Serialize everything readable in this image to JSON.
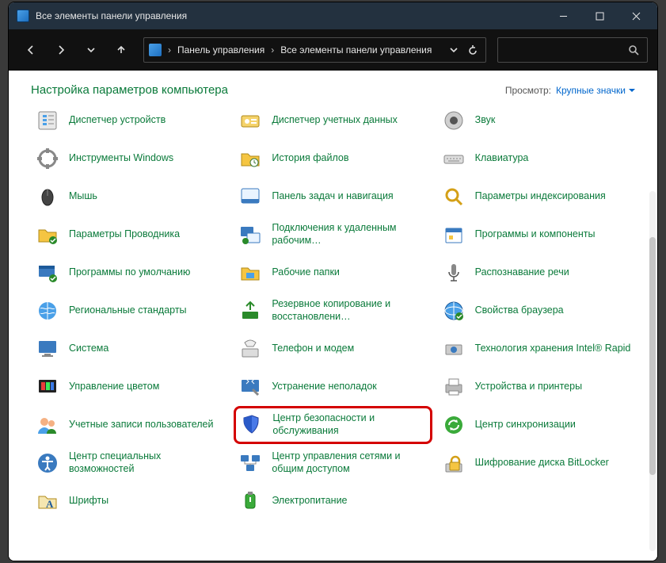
{
  "window": {
    "title": "Все элементы панели управления"
  },
  "breadcrumb": {
    "seg1": "Панель управления",
    "seg2": "Все элементы панели управления"
  },
  "header": {
    "title": "Настройка параметров компьютера",
    "view_label": "Просмотр:",
    "view_value": "Крупные значки"
  },
  "items": [
    {
      "label": "Диспетчер устройств",
      "icon": "device-manager-icon"
    },
    {
      "label": "Диспетчер учетных данных",
      "icon": "credentials-icon"
    },
    {
      "label": "Звук",
      "icon": "sound-icon"
    },
    {
      "label": "Инструменты Windows",
      "icon": "tools-icon"
    },
    {
      "label": "История файлов",
      "icon": "file-history-icon"
    },
    {
      "label": "Клавиатура",
      "icon": "keyboard-icon"
    },
    {
      "label": "Мышь",
      "icon": "mouse-icon"
    },
    {
      "label": "Панель задач и навигация",
      "icon": "taskbar-icon"
    },
    {
      "label": "Параметры индексирования",
      "icon": "indexing-icon"
    },
    {
      "label": "Параметры Проводника",
      "icon": "explorer-options-icon"
    },
    {
      "label": "Подключения к удаленным рабочим…",
      "icon": "remote-icon"
    },
    {
      "label": "Программы и компоненты",
      "icon": "programs-icon"
    },
    {
      "label": "Программы по умолчанию",
      "icon": "default-programs-icon"
    },
    {
      "label": "Рабочие папки",
      "icon": "work-folders-icon"
    },
    {
      "label": "Распознавание речи",
      "icon": "speech-icon"
    },
    {
      "label": "Региональные стандарты",
      "icon": "region-icon"
    },
    {
      "label": "Резервное копирование и восстановлени…",
      "icon": "backup-icon"
    },
    {
      "label": "Свойства браузера",
      "icon": "internet-options-icon"
    },
    {
      "label": "Система",
      "icon": "system-icon"
    },
    {
      "label": "Телефон и модем",
      "icon": "phone-modem-icon"
    },
    {
      "label": "Технология хранения Intel® Rapid",
      "icon": "intel-rapid-icon"
    },
    {
      "label": "Управление цветом",
      "icon": "color-mgmt-icon"
    },
    {
      "label": "Устранение неполадок",
      "icon": "troubleshoot-icon"
    },
    {
      "label": "Устройства и принтеры",
      "icon": "devices-printers-icon"
    },
    {
      "label": "Учетные записи пользователей",
      "icon": "user-accounts-icon"
    },
    {
      "label": "Центр безопасности и обслуживания",
      "icon": "security-center-icon",
      "highlight": true
    },
    {
      "label": "Центр синхронизации",
      "icon": "sync-center-icon"
    },
    {
      "label": "Центр специальных возможностей",
      "icon": "ease-of-access-icon"
    },
    {
      "label": "Центр управления сетями и общим доступом",
      "icon": "network-center-icon"
    },
    {
      "label": "Шифрование диска BitLocker",
      "icon": "bitlocker-icon"
    },
    {
      "label": "Шрифты",
      "icon": "fonts-icon"
    },
    {
      "label": "Электропитание",
      "icon": "power-options-icon"
    }
  ]
}
